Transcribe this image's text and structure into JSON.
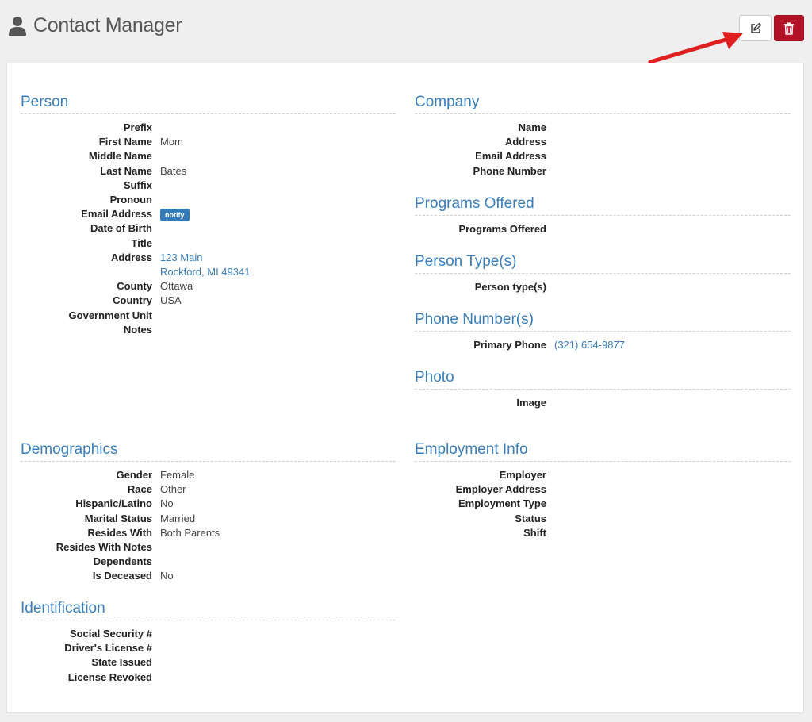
{
  "header": {
    "title": "Contact Manager",
    "icon": "person-icon",
    "edit_icon": "edit-icon",
    "delete_icon": "trash-icon",
    "delete_color": "#b11226"
  },
  "person": {
    "heading": "Person",
    "rows": [
      {
        "label": "Prefix",
        "value": ""
      },
      {
        "label": "First Name",
        "value": "Mom"
      },
      {
        "label": "Middle Name",
        "value": ""
      },
      {
        "label": "Last Name",
        "value": "Bates"
      },
      {
        "label": "Suffix",
        "value": ""
      },
      {
        "label": "Pronoun",
        "value": ""
      },
      {
        "label": "Email Address",
        "badge": "notify"
      },
      {
        "label": "Date of Birth",
        "value": ""
      },
      {
        "label": "Title",
        "value": ""
      },
      {
        "label": "Address",
        "value_line1": "123 Main",
        "value_line2": "Rockford, MI 49341"
      },
      {
        "label": "County",
        "value": "Ottawa"
      },
      {
        "label": "Country",
        "value": "USA"
      },
      {
        "label": "Government Unit",
        "value": ""
      },
      {
        "label": "Notes",
        "value": ""
      }
    ]
  },
  "company": {
    "heading": "Company",
    "rows": [
      {
        "label": "Name"
      },
      {
        "label": "Address"
      },
      {
        "label": "Email Address"
      },
      {
        "label": "Phone Number"
      }
    ]
  },
  "programs": {
    "heading": "Programs Offered",
    "rows": [
      {
        "label": "Programs Offered"
      }
    ]
  },
  "person_types": {
    "heading": "Person Type(s)",
    "rows": [
      {
        "label": "Person type(s)"
      }
    ]
  },
  "phones": {
    "heading": "Phone Number(s)",
    "rows": [
      {
        "label": "Primary Phone",
        "value": "(321) 654-9877"
      }
    ]
  },
  "photo": {
    "heading": "Photo",
    "rows": [
      {
        "label": "Image"
      }
    ]
  },
  "demographics": {
    "heading": "Demographics",
    "rows": [
      {
        "label": "Gender",
        "value": "Female"
      },
      {
        "label": "Race",
        "value": "Other"
      },
      {
        "label": "Hispanic/Latino",
        "value": "No"
      },
      {
        "label": "Marital Status",
        "value": "Married"
      },
      {
        "label": "Resides With",
        "value": "Both Parents"
      },
      {
        "label": "Resides With Notes",
        "value": ""
      },
      {
        "label": "Dependents",
        "value": ""
      },
      {
        "label": "Is Deceased",
        "value": "No"
      }
    ]
  },
  "employment": {
    "heading": "Employment Info",
    "rows": [
      {
        "label": "Employer"
      },
      {
        "label": "Employer Address"
      },
      {
        "label": "Employment Type"
      },
      {
        "label": "Status"
      },
      {
        "label": "Shift"
      }
    ]
  },
  "identification": {
    "heading": "Identification",
    "rows": [
      {
        "label": "Social Security #"
      },
      {
        "label": "Driver's License #"
      },
      {
        "label": "State Issued"
      },
      {
        "label": "License Revoked"
      }
    ]
  },
  "colors": {
    "heading": "#3a7db8",
    "link": "#3a7db8",
    "badge": "#337ab7",
    "arrow": "#e02020"
  }
}
